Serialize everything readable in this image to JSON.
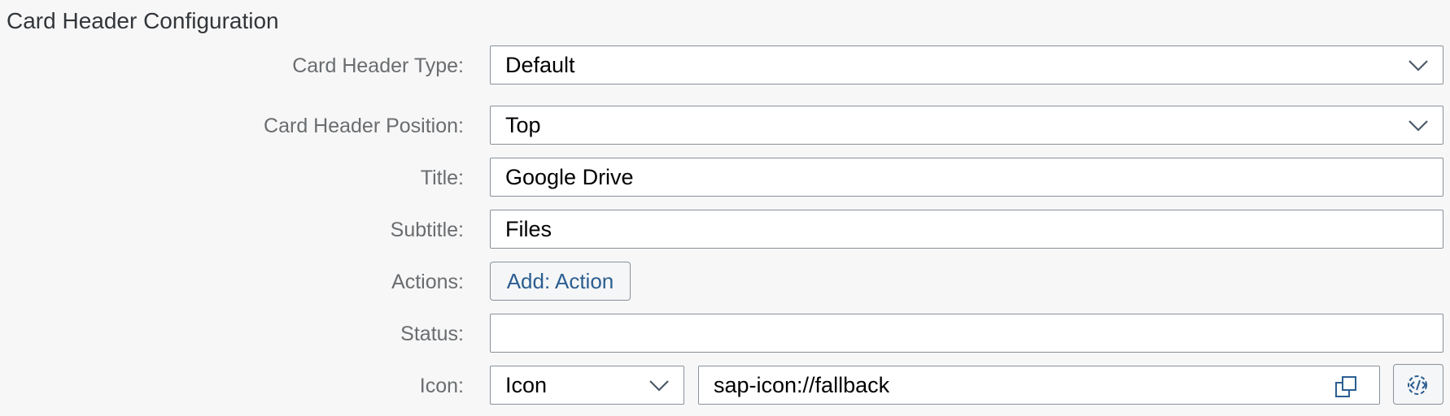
{
  "section": {
    "title": "Card Header Configuration"
  },
  "fields": {
    "header_type": {
      "label": "Card Header Type:",
      "value": "Default",
      "icon": "chevron-down-icon"
    },
    "header_position": {
      "label": "Card Header Position:",
      "value": "Top",
      "icon": "chevron-down-icon"
    },
    "title": {
      "label": "Title:",
      "value": "Google Drive"
    },
    "subtitle": {
      "label": "Subtitle:",
      "value": "Files"
    },
    "actions": {
      "label": "Actions:",
      "button_label": "Add: Action"
    },
    "status": {
      "label": "Status:",
      "value": ""
    },
    "icon": {
      "label": "Icon:",
      "type_value": "Icon",
      "src_value": "sap-icon://fallback",
      "copy_icon": "copy-icon",
      "settings_icon": "gear-code-icon"
    }
  },
  "colors": {
    "link": "#2b5e91",
    "border": "#89919a",
    "label": "#6a6d70",
    "background": "#f7f7f7"
  }
}
